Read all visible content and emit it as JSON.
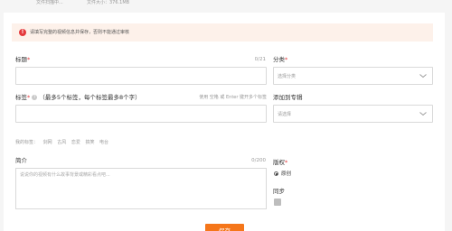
{
  "topbar": {
    "status_text": "文件扫描中...",
    "size_text": "文件大小：376.1MB"
  },
  "alert": {
    "icon": "exclamation-icon",
    "text": "请填写完整的视频信息并保存，否则不能通过审核"
  },
  "form": {
    "title": {
      "label": "标题",
      "required_mark": "*",
      "counter": "0/21",
      "value": ""
    },
    "category": {
      "label": "分类",
      "required_mark": "*",
      "placeholder": "选择分类"
    },
    "tags": {
      "label": "标签",
      "required_mark": "*",
      "hint": "（最多5个标签，每个标签最多8个字）",
      "help_right": "使用 空格 或 Enter 键开多个标签",
      "value": "",
      "my_tags_label": "我的标签：",
      "my_tags": [
        "剑网",
        "古风",
        "恋爱",
        "搞笑",
        "电台"
      ]
    },
    "collection": {
      "label": "添加到专辑",
      "placeholder": "请选择"
    },
    "intro": {
      "label": "简介",
      "counter": "0/200",
      "placeholder": "说说你的视频有什么故事背景或精彩看点吧..."
    },
    "license": {
      "label": "版权",
      "required_mark": "*",
      "selected_option": "原创"
    },
    "sync": {
      "label": "同步"
    },
    "save_label": "保存"
  },
  "colors": {
    "accent": "#f5761a",
    "error": "#e4393c",
    "alert_bg": "#fdf1ea"
  }
}
